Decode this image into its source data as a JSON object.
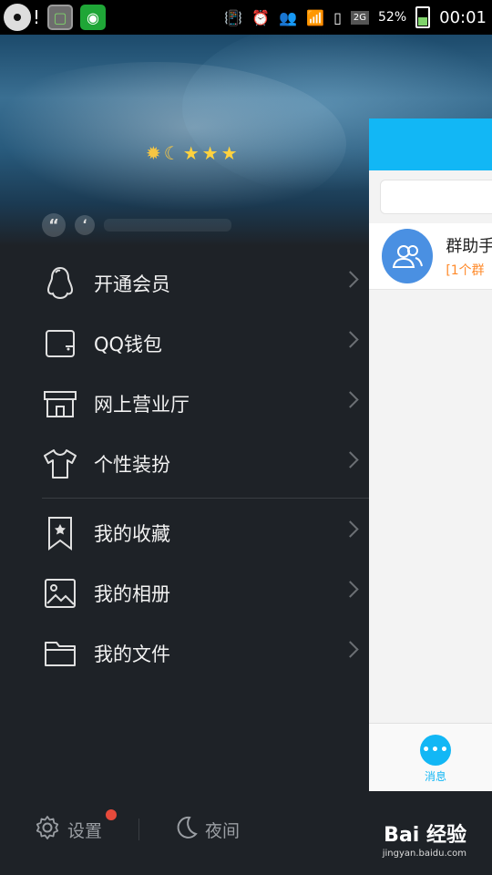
{
  "status_bar": {
    "notification": "!",
    "network": "2G",
    "battery": "52%",
    "time": "00:01"
  },
  "profile": {
    "level_icons": [
      "sun",
      "moon",
      "star",
      "star",
      "star"
    ],
    "quote_mark": "“",
    "quote_mark_small": "‘"
  },
  "menu": {
    "items_top": [
      {
        "label": "开通会员",
        "icon": "penguin-icon"
      },
      {
        "label": "QQ钱包",
        "icon": "wallet-icon"
      },
      {
        "label": "网上营业厅",
        "icon": "storefront-icon"
      },
      {
        "label": "个性装扮",
        "icon": "tshirt-icon"
      }
    ],
    "items_bottom": [
      {
        "label": "我的收藏",
        "icon": "bookmark-icon"
      },
      {
        "label": "我的相册",
        "icon": "image-icon"
      },
      {
        "label": "我的文件",
        "icon": "folder-icon"
      }
    ]
  },
  "bottom_bar": {
    "settings_label": "设置",
    "night_label": "夜间"
  },
  "main_screen": {
    "chat_name": "群助手",
    "chat_preview": "[1个群",
    "tab_message_label": "消息",
    "tab_message_icon_text": "•••"
  },
  "watermark": {
    "main": "Bai 经验",
    "sub": "jingyan.baidu.com"
  }
}
